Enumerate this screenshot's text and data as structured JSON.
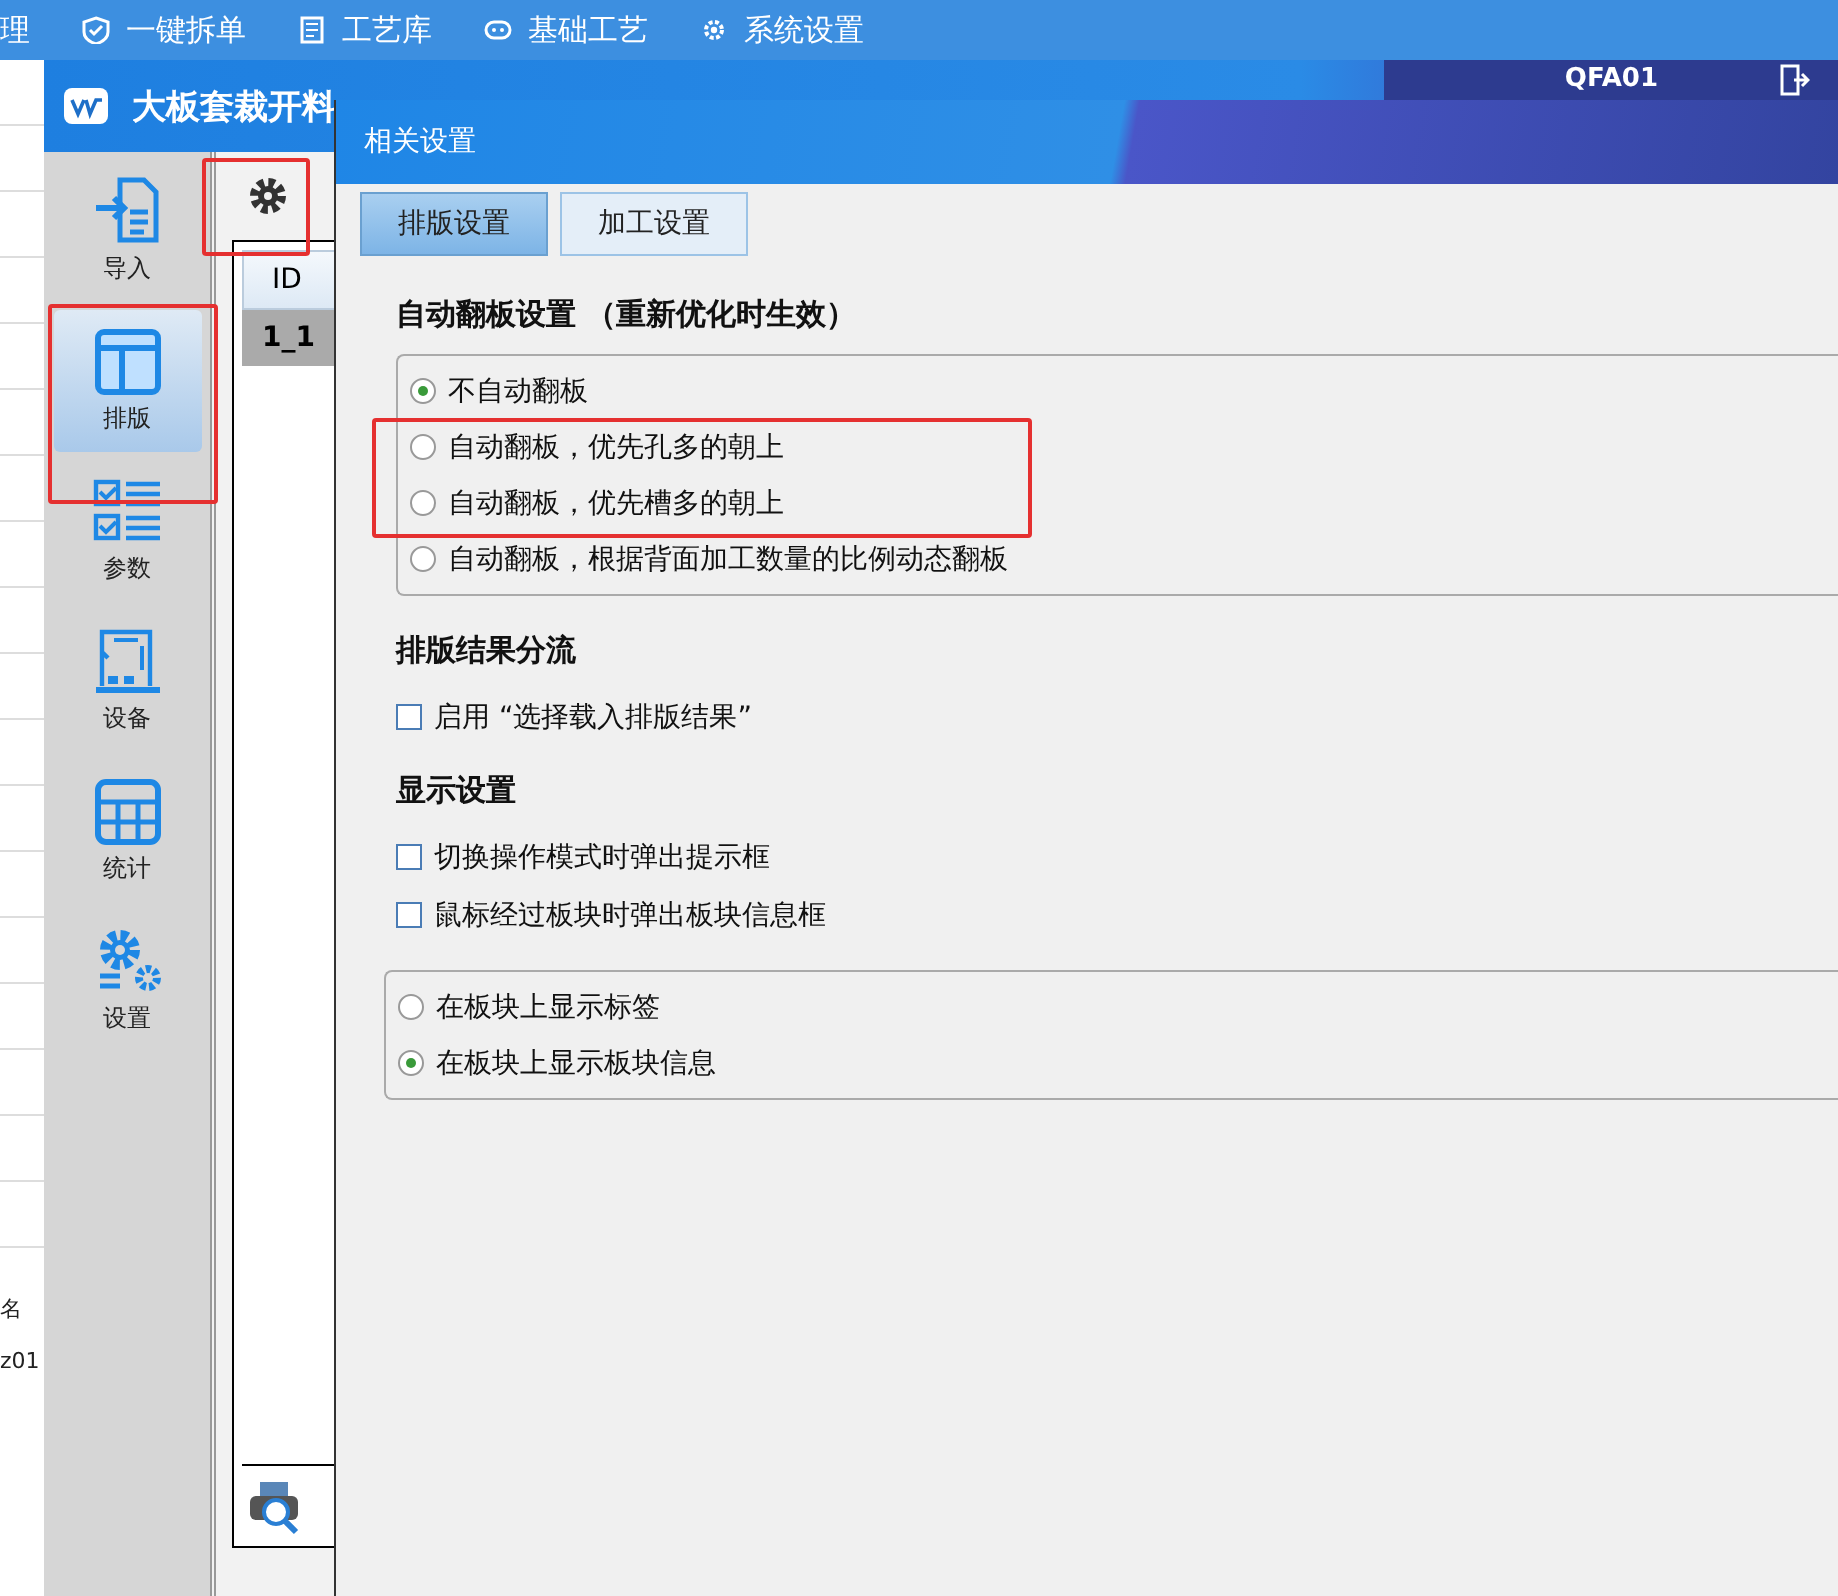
{
  "top_menu": [
    {
      "label": "理"
    },
    {
      "label": "一键拆单"
    },
    {
      "label": "工艺库"
    },
    {
      "label": "基础工艺"
    },
    {
      "label": "系统设置"
    }
  ],
  "back_table": {
    "cells": [
      "名",
      "z01"
    ]
  },
  "main_window": {
    "title": "大板套裁开料",
    "machine": "QFA01"
  },
  "sidebar": {
    "items": [
      {
        "label": "导入",
        "selected": false
      },
      {
        "label": "排版",
        "selected": true
      },
      {
        "label": "参数",
        "selected": false
      },
      {
        "label": "设备",
        "selected": false
      },
      {
        "label": "统计",
        "selected": false
      },
      {
        "label": "设置",
        "selected": false
      }
    ]
  },
  "list_panel": {
    "columns": [
      "ID"
    ],
    "rows": [
      {
        "id": "1_1",
        "selected": true
      }
    ]
  },
  "dialog": {
    "title": "相关设置",
    "tabs": [
      {
        "label": "排版设置",
        "selected": true
      },
      {
        "label": "加工设置",
        "selected": false
      }
    ],
    "sections": [
      {
        "title": "自动翻板设置 （重新优化时生效）",
        "kind": "radio",
        "options": [
          {
            "label": "不自动翻板",
            "checked": true
          },
          {
            "label": "自动翻板，优先孔多的朝上",
            "checked": false
          },
          {
            "label": "自动翻板，优先槽多的朝上",
            "checked": false
          },
          {
            "label": "自动翻板，根据背面加工数量的比例动态翻板",
            "checked": false
          }
        ]
      },
      {
        "title": "排版结果分流",
        "kind": "check",
        "options": [
          {
            "label": "启用 “选择载入排版结果”",
            "checked": false
          }
        ]
      },
      {
        "title": "显示设置",
        "kind": "check",
        "options": [
          {
            "label": "切换操作模式时弹出提示框",
            "checked": false
          },
          {
            "label": "鼠标经过板块时弹出板块信息框",
            "checked": false
          }
        ]
      },
      {
        "kind": "radio",
        "options": [
          {
            "label": "在板块上显示标签",
            "checked": false
          },
          {
            "label": "在板块上显示板块信息",
            "checked": true
          }
        ]
      }
    ]
  }
}
